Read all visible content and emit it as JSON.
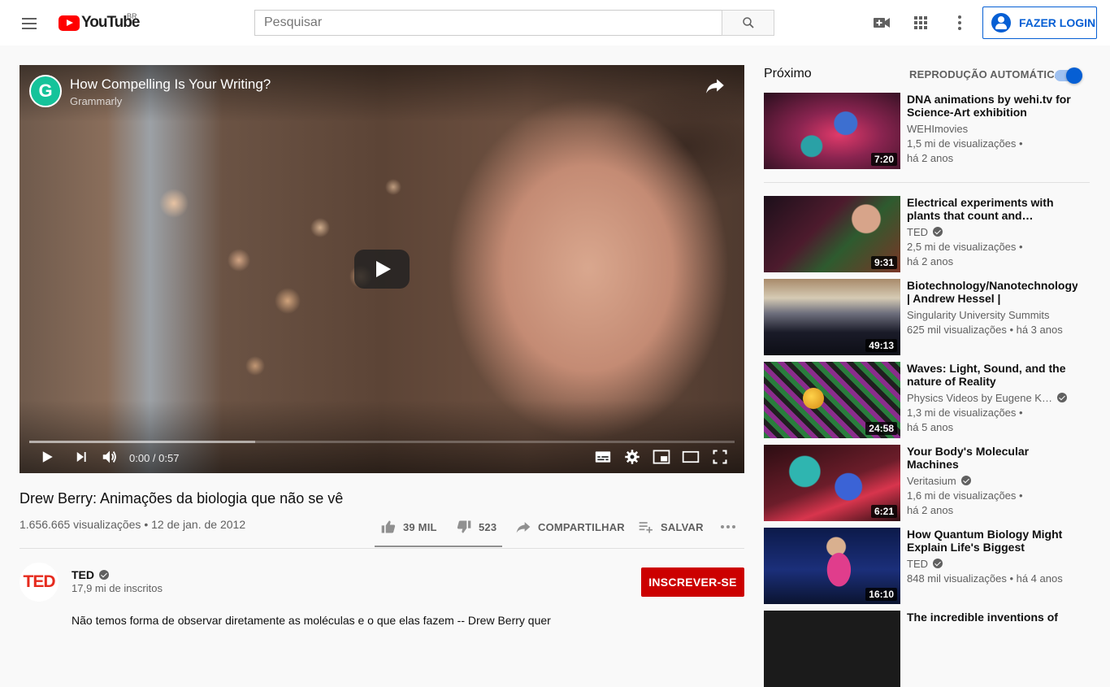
{
  "header": {
    "logo_text": "YouTube",
    "country_code": "BR",
    "search_placeholder": "Pesquisar",
    "login_label": "FAZER LOGIN"
  },
  "player": {
    "title": "How Compelling Is Your Writing?",
    "channel": "Grammarly",
    "channel_logo_letter": "G",
    "time": "0:00 / 0:57",
    "buffered_fraction": 0.32
  },
  "video": {
    "title": "Drew Berry: Animações da biologia que não se vê",
    "meta": "1.656.665 visualizações • 12 de jan. de 2012",
    "likes": "39 MIL",
    "dislikes": "523",
    "share_label": "COMPARTILHAR",
    "save_label": "SALVAR",
    "description": "Não temos forma de observar diretamente as moléculas e o que elas fazem -- Drew Berry quer"
  },
  "owner": {
    "avatar_text": "TED",
    "name": "TED",
    "subscribers": "17,9 mi de inscritos",
    "subscribe_label": "INSCREVER-SE"
  },
  "sidebar": {
    "up_next": "Próximo",
    "autoplay": "REPRODUÇÃO AUTOMÁTICA",
    "autoplay_on": true,
    "items": [
      {
        "title": "DNA animations by wehi.tv for Science-Art exhibition",
        "channel": "WEHImovies",
        "verified": false,
        "line1": "1,5 mi de visualizações •",
        "line2": "há 2 anos",
        "duration": "7:20"
      },
      {
        "title": "Electrical experiments with plants that count and…",
        "channel": "TED",
        "verified": true,
        "line1": "2,5 mi de visualizações •",
        "line2": "há 2 anos",
        "duration": "9:31"
      },
      {
        "title": "Biotechnology/Nanotechnology | Andrew Hessel | SingularityU…",
        "channel": "Singularity University Summits",
        "verified": false,
        "line1": "625 mil visualizações • há 3 anos",
        "line2": "",
        "duration": "49:13"
      },
      {
        "title": "Waves: Light, Sound, and the nature of Reality",
        "channel": "Physics Videos by Eugene K…",
        "verified": true,
        "line1": "1,3 mi de visualizações •",
        "line2": "há 5 anos",
        "duration": "24:58"
      },
      {
        "title": "Your Body's Molecular Machines",
        "channel": "Veritasium",
        "verified": true,
        "line1": "1,6 mi de visualizações •",
        "line2": "há 2 anos",
        "duration": "6:21"
      },
      {
        "title": "How Quantum Biology Might Explain Life's Biggest Question…",
        "channel": "TED",
        "verified": true,
        "line1": "848 mil visualizações • há 4 anos",
        "line2": "",
        "duration": "16:10"
      },
      {
        "title": "The incredible inventions of",
        "channel": "",
        "verified": false,
        "line1": "",
        "line2": "",
        "duration": ""
      }
    ]
  },
  "colors": {
    "brand_red": "#ff0000",
    "subscribe_red": "#cc0000",
    "link_blue": "#065fd4"
  }
}
